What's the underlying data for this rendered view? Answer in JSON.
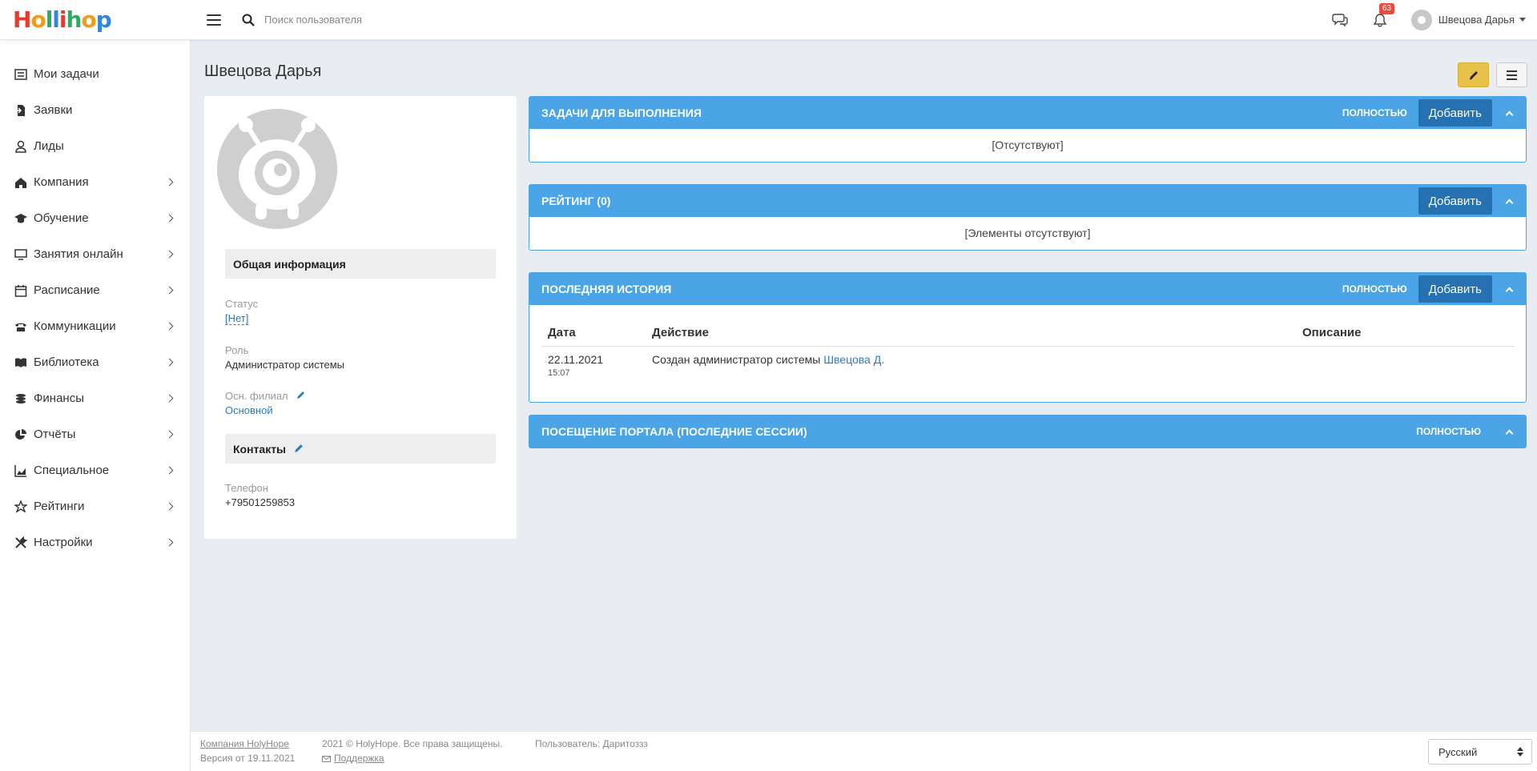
{
  "topbar": {
    "logo_letters": [
      "H",
      "o",
      "l",
      "l",
      "i",
      "h",
      "o",
      "p"
    ],
    "logo_colors": [
      "#e63b2e",
      "#f39c12",
      "#27ae60",
      "#2e86de",
      "#e63b2e",
      "#27ae60",
      "#f39c12",
      "#2e86de"
    ],
    "search_placeholder": "Поиск пользователя",
    "notification_count": "63",
    "user_name": "Швецова Дарья"
  },
  "sidebar": {
    "items": [
      {
        "label": "Мои задачи",
        "icon": "list-icon",
        "has_submenu": false
      },
      {
        "label": "Заявки",
        "icon": "request-icon",
        "has_submenu": false
      },
      {
        "label": "Лиды",
        "icon": "user-icon",
        "has_submenu": false
      },
      {
        "label": "Компания",
        "icon": "home-icon",
        "has_submenu": true
      },
      {
        "label": "Обучение",
        "icon": "graduation-cap-icon",
        "has_submenu": true
      },
      {
        "label": "Занятия онлайн",
        "icon": "monitor-icon",
        "has_submenu": true
      },
      {
        "label": "Расписание",
        "icon": "calendar-icon",
        "has_submenu": true
      },
      {
        "label": "Коммуникации",
        "icon": "phone-icon",
        "has_submenu": true
      },
      {
        "label": "Библиотека",
        "icon": "book-icon",
        "has_submenu": true
      },
      {
        "label": "Финансы",
        "icon": "coins-icon",
        "has_submenu": true
      },
      {
        "label": "Отчёты",
        "icon": "pie-chart-icon",
        "has_submenu": true
      },
      {
        "label": "Специальное",
        "icon": "area-chart-icon",
        "has_submenu": true
      },
      {
        "label": "Рейтинги",
        "icon": "star-icon",
        "has_submenu": true
      },
      {
        "label": "Настройки",
        "icon": "tools-icon",
        "has_submenu": true
      }
    ]
  },
  "page": {
    "title": "Швецова Дарья"
  },
  "profile": {
    "general_info_title": "Общая информация",
    "status_label": "Статус",
    "status_value": "[Нет]",
    "role_label": "Роль",
    "role_value": "Администратор системы",
    "branch_label": "Осн. филиал",
    "branch_value": "Основной",
    "contacts_title": "Контакты",
    "phone_label": "Телефон",
    "phone_value": "+79501259853"
  },
  "panels": {
    "tasks": {
      "title": "ЗАДАЧИ ДЛЯ ВЫПОЛНЕНИЯ",
      "full_link": "ПОЛНОСТЬЮ",
      "add_label": "Добавить",
      "empty_text": "[Отсутствуют]"
    },
    "rating": {
      "title": "РЕЙТИНГ (0)",
      "add_label": "Добавить",
      "empty_text": "[Элементы отсутствуют]"
    },
    "history": {
      "title": "ПОСЛЕДНЯЯ ИСТОРИЯ",
      "full_link": "ПОЛНОСТЬЮ",
      "add_label": "Добавить",
      "columns": [
        "Дата",
        "Действие",
        "Описание"
      ],
      "rows": [
        {
          "date": "22.11.2021",
          "time": "15:07",
          "action_text": "Создан администратор системы",
          "action_link": "Швецова Д.",
          "description": ""
        }
      ]
    },
    "portal": {
      "title": "ПОСЕЩЕНИЕ ПОРТАЛА (ПОСЛЕДНИЕ СЕССИИ)",
      "full_link": "ПОЛНОСТЬЮ"
    }
  },
  "footer": {
    "company_link": "Компания HolyHope",
    "version": "Версия от 19.11.2021",
    "copyright": "2021 © HolyHope. Все права защищены.",
    "support_link": "Поддержка",
    "user_text": "Пользователь: Даритоззз",
    "language": "Русский"
  }
}
